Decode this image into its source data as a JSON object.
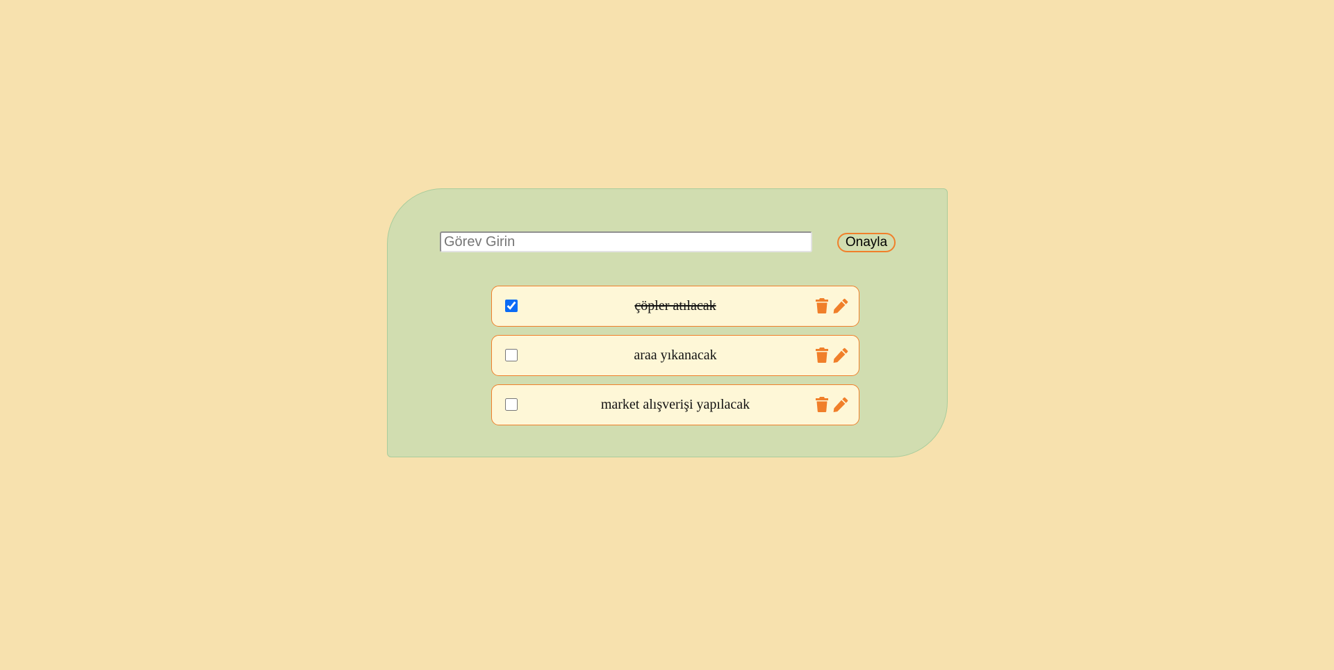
{
  "form": {
    "input_placeholder": "Görev Girin",
    "input_value": "",
    "confirm_label": "Onayla"
  },
  "tasks": [
    {
      "text": "çöpler atılacak",
      "done": true
    },
    {
      "text": "araa yıkanacak",
      "done": false
    },
    {
      "text": "market alışverişi yapılacak",
      "done": false
    }
  ],
  "icons": {
    "delete": "trash-icon",
    "edit": "pencil-icon"
  },
  "colors": {
    "page_background": "#f7e1ae",
    "card_background": "#d1ddb0",
    "accent": "#f07f2a",
    "task_background": "#fef7d7"
  }
}
